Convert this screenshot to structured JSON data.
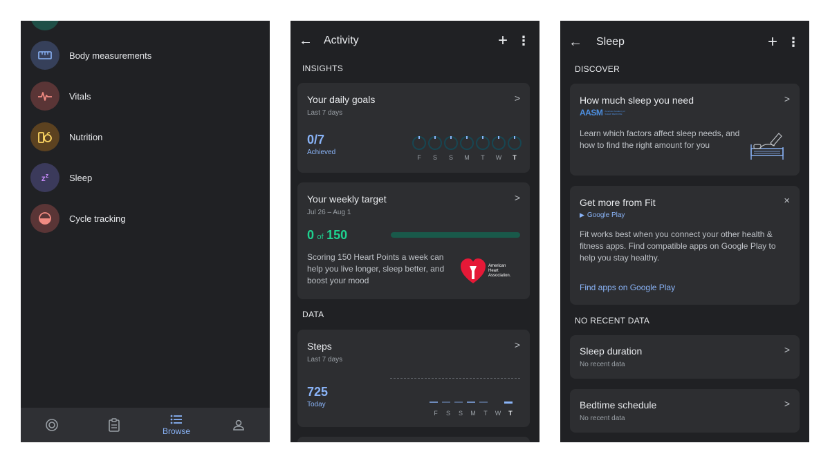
{
  "browse": {
    "categories": [
      {
        "label": "Body measurements",
        "icon": "ruler-icon",
        "bg": "#36405a",
        "color": "#8ab4f8"
      },
      {
        "label": "Vitals",
        "icon": "heartbeat-icon",
        "bg": "#5a3536",
        "color": "#f28b82"
      },
      {
        "label": "Nutrition",
        "icon": "apple-icon",
        "bg": "#5c4220",
        "color": "#fdd663"
      },
      {
        "label": "Sleep",
        "icon": "zzz-icon",
        "bg": "#3b3a5b",
        "color": "#c58af9"
      },
      {
        "label": "Cycle tracking",
        "icon": "cycle-icon",
        "bg": "#5a3536",
        "color": "#f28b82"
      }
    ],
    "nav": {
      "browse_label": "Browse"
    }
  },
  "activity": {
    "title": "Activity",
    "insights_label": "INSIGHTS",
    "daily_goals": {
      "title": "Your daily goals",
      "subtitle": "Last 7 days",
      "value": "0/7",
      "value_label": "Achieved",
      "days": [
        "F",
        "S",
        "S",
        "M",
        "T",
        "W",
        "T"
      ]
    },
    "weekly_target": {
      "title": "Your weekly target",
      "subtitle": "Jul 26 – Aug 1",
      "value": "0",
      "of": "of",
      "target": "150",
      "progress": 0,
      "text": "Scoring 150 Heart Points a week can help you live longer, sleep better, and boost your mood",
      "aha_line1": "American",
      "aha_line2": "Heart",
      "aha_line3": "Association."
    },
    "data_label": "DATA",
    "steps": {
      "title": "Steps",
      "subtitle": "Last 7 days",
      "value": "725",
      "value_label": "Today",
      "days": [
        "F",
        "S",
        "S",
        "M",
        "T",
        "W",
        "T"
      ]
    }
  },
  "sleep": {
    "title": "Sleep",
    "discover_label": "DISCOVER",
    "how_much": {
      "title": "How much sleep you need",
      "brand": "AASM",
      "brand_sub": "American Academy of SLEEP MEDICINE",
      "text": "Learn which factors affect sleep needs, and how to find the right amount for you"
    },
    "get_more": {
      "title": "Get more from Fit",
      "source": "Google Play",
      "text": "Fit works best when you connect your other health & fitness apps. Find compatible apps on Google Play to help you stay healthy.",
      "link": "Find apps on Google Play"
    },
    "no_recent_label": "NO RECENT DATA",
    "duration": {
      "title": "Sleep duration",
      "subtitle": "No recent data"
    },
    "bedtime": {
      "title": "Bedtime schedule",
      "subtitle": "No recent data"
    }
  },
  "colors": {
    "background": "#202124",
    "card": "#2d2e31",
    "accent_blue": "#8ab4f8",
    "accent_green": "#1ed28f"
  }
}
